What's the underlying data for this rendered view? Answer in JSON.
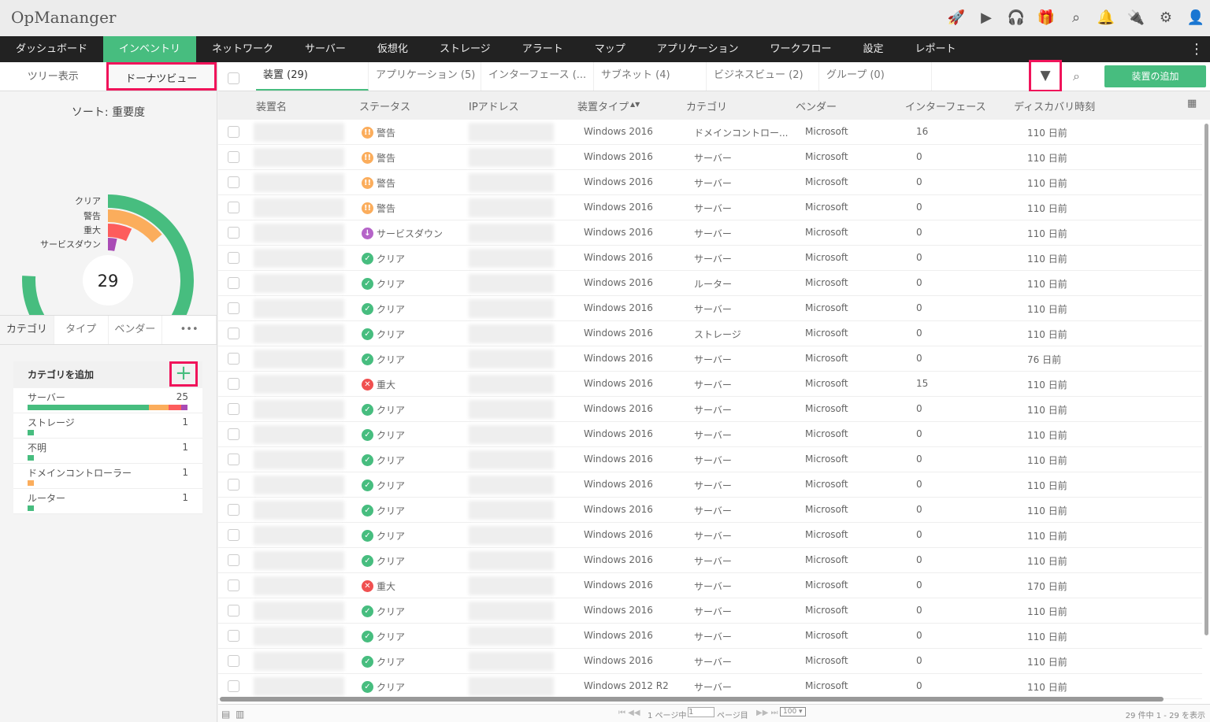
{
  "app": {
    "title": "OpMananger"
  },
  "top_icons": [
    "rocket-icon",
    "presentation-icon",
    "headset-icon",
    "gift-icon",
    "search-icon",
    "bell-icon",
    "plug-icon",
    "gear-icon",
    "avatar-icon"
  ],
  "nav": [
    "ダッシュボード",
    "インベントリ",
    "ネットワーク",
    "サーバー",
    "仮想化",
    "ストレージ",
    "アラート",
    "マップ",
    "アプリケーション",
    "ワークフロー",
    "設定",
    "レポート"
  ],
  "view_tabs": [
    "ツリー表示",
    "ドーナツビュー"
  ],
  "sort_title": "ソート: 重要度",
  "donut": {
    "total": "29",
    "segments": [
      {
        "label": "クリア",
        "value": 22,
        "color": "#47bd7f"
      },
      {
        "label": "警告",
        "value": 4,
        "color": "#fbad5c"
      },
      {
        "label": "重大",
        "value": 2,
        "color": "#fd5c5c"
      },
      {
        "label": "サービスダウン",
        "value": 1,
        "color": "#a94bb5"
      }
    ]
  },
  "cat_tabs": [
    "カテゴリ",
    "タイプ",
    "ベンダー",
    "•••"
  ],
  "cat_panel": {
    "title": "カテゴリを追加",
    "items": [
      {
        "name": "サーバー",
        "count": "25",
        "bar": [
          [
            19,
            "#47bd7f"
          ],
          [
            3,
            "#fbad5c"
          ],
          [
            2,
            "#fd5c5c"
          ],
          [
            1,
            "#a94bb5"
          ]
        ]
      },
      {
        "name": "ストレージ",
        "count": "1",
        "bar": [
          [
            1,
            "#47bd7f"
          ]
        ]
      },
      {
        "name": "不明",
        "count": "1",
        "bar": [
          [
            1,
            "#47bd7f"
          ]
        ]
      },
      {
        "name": "ドメインコントローラー",
        "count": "1",
        "bar": [
          [
            1,
            "#fbad5c"
          ]
        ]
      },
      {
        "name": "ルーター",
        "count": "1",
        "bar": [
          [
            1,
            "#47bd7f"
          ]
        ]
      }
    ]
  },
  "tabs": [
    "装置 (29)",
    "アプリケーション (5)",
    "インターフェース (...",
    "サブネット (4)",
    "ビジネスビュー (2)",
    "グループ (0)"
  ],
  "add_device": "装置の追加",
  "columns": [
    "装置名",
    "ステータス",
    "IPアドレス",
    "装置タイプ",
    "カテゴリ",
    "ベンダー",
    "インターフェース",
    "ディスカバリ時刻"
  ],
  "status_styles": {
    "警告": {
      "color": "#fbad5c",
      "glyph": "!!"
    },
    "サービスダウン": {
      "color": "#b564c8",
      "glyph": "↓"
    },
    "クリア": {
      "color": "#47bd7f",
      "glyph": "✓"
    },
    "重大": {
      "color": "#f05050",
      "glyph": "✕"
    }
  },
  "rows": [
    [
      "警告",
      "Windows 2016",
      "ドメインコントロー...",
      "Microsoft",
      "16",
      "110 日前"
    ],
    [
      "警告",
      "Windows 2016",
      "サーバー",
      "Microsoft",
      "0",
      "110 日前"
    ],
    [
      "警告",
      "Windows 2016",
      "サーバー",
      "Microsoft",
      "0",
      "110 日前"
    ],
    [
      "警告",
      "Windows 2016",
      "サーバー",
      "Microsoft",
      "0",
      "110 日前"
    ],
    [
      "サービスダウン",
      "Windows 2016",
      "サーバー",
      "Microsoft",
      "0",
      "110 日前"
    ],
    [
      "クリア",
      "Windows 2016",
      "サーバー",
      "Microsoft",
      "0",
      "110 日前"
    ],
    [
      "クリア",
      "Windows 2016",
      "ルーター",
      "Microsoft",
      "0",
      "110 日前"
    ],
    [
      "クリア",
      "Windows 2016",
      "サーバー",
      "Microsoft",
      "0",
      "110 日前"
    ],
    [
      "クリア",
      "Windows 2016",
      "ストレージ",
      "Microsoft",
      "0",
      "110 日前"
    ],
    [
      "クリア",
      "Windows 2016",
      "サーバー",
      "Microsoft",
      "0",
      "76 日前"
    ],
    [
      "重大",
      "Windows 2016",
      "サーバー",
      "Microsoft",
      "15",
      "110 日前"
    ],
    [
      "クリア",
      "Windows 2016",
      "サーバー",
      "Microsoft",
      "0",
      "110 日前"
    ],
    [
      "クリア",
      "Windows 2016",
      "サーバー",
      "Microsoft",
      "0",
      "110 日前"
    ],
    [
      "クリア",
      "Windows 2016",
      "サーバー",
      "Microsoft",
      "0",
      "110 日前"
    ],
    [
      "クリア",
      "Windows 2016",
      "サーバー",
      "Microsoft",
      "0",
      "110 日前"
    ],
    [
      "クリア",
      "Windows 2016",
      "サーバー",
      "Microsoft",
      "0",
      "110 日前"
    ],
    [
      "クリア",
      "Windows 2016",
      "サーバー",
      "Microsoft",
      "0",
      "110 日前"
    ],
    [
      "クリア",
      "Windows 2016",
      "サーバー",
      "Microsoft",
      "0",
      "110 日前"
    ],
    [
      "重大",
      "Windows 2016",
      "サーバー",
      "Microsoft",
      "0",
      "170 日前"
    ],
    [
      "クリア",
      "Windows 2016",
      "サーバー",
      "Microsoft",
      "0",
      "110 日前"
    ],
    [
      "クリア",
      "Windows 2016",
      "サーバー",
      "Microsoft",
      "0",
      "110 日前"
    ],
    [
      "クリア",
      "Windows 2016",
      "サーバー",
      "Microsoft",
      "0",
      "110 日前"
    ],
    [
      "クリア",
      "Windows 2012 R2",
      "サーバー",
      "Microsoft",
      "0",
      "110 日前"
    ]
  ],
  "pager": {
    "of": "1 ページ中",
    "page": "1",
    "suffix": "ページ目",
    "per_page": "100 ▾",
    "summary": "29 件中 1 - 29 を表示"
  }
}
